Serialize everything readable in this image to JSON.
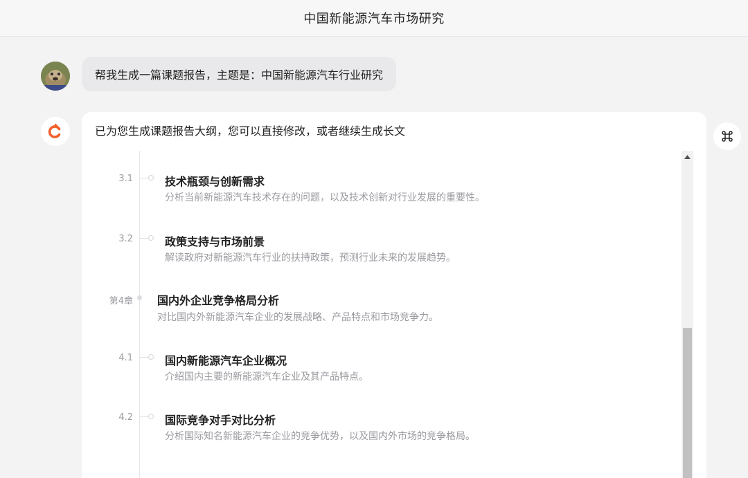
{
  "header": {
    "title": "中国新能源汽车市场研究"
  },
  "user_message": {
    "text": "帮我生成一篇课题报告，主题是：中国新能源汽车行业研究"
  },
  "assistant": {
    "intro": "已为您生成课题报告大纲，您可以直接修改，或者继续生成长文",
    "outline": [
      {
        "kind": "section",
        "num": "3.1",
        "title": "技术瓶颈与创新需求",
        "desc": "分析当前新能源汽车技术存在的问题，以及技术创新对行业发展的重要性。"
      },
      {
        "kind": "section",
        "num": "3.2",
        "title": "政策支持与市场前景",
        "desc": "解读政府对新能源汽车行业的扶持政策，预测行业未来的发展趋势。"
      },
      {
        "kind": "chapter",
        "num": "第4章",
        "title": "国内外企业竞争格局分析",
        "desc": "对比国内外新能源汽车企业的发展战略、产品特点和市场竞争力。"
      },
      {
        "kind": "section",
        "num": "4.1",
        "title": "国内新能源汽车企业概况",
        "desc": "介绍国内主要的新能源汽车企业及其产品特点。"
      },
      {
        "kind": "section",
        "num": "4.2",
        "title": "国际竞争对手对比分析",
        "desc": "分析国际知名新能源汽车企业的竞争优势，以及国内外市场的竞争格局。"
      }
    ]
  },
  "icons": {
    "side_action": "command-icon",
    "assistant_avatar": "orange-c-logo-icon",
    "scroll_up": "scroll-up-arrow-icon"
  },
  "colors": {
    "accent": "#f2602a",
    "background": "#f3f3f4",
    "bubble": "#e9e9eb",
    "muted_text": "#9a9aa0"
  }
}
